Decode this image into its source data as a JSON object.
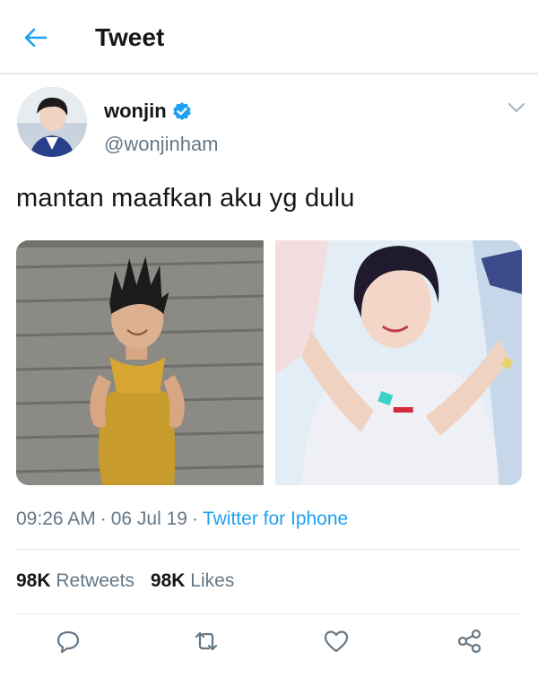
{
  "header": {
    "title": "Tweet",
    "back_icon": "arrow-left-icon"
  },
  "tweet": {
    "author": {
      "display_name": "wonjin",
      "handle": "@wonjinham",
      "verified": true
    },
    "text": "mantan maafkan aku yg dulu",
    "time": "09:26 AM",
    "date": "06 Jul 19",
    "separator": "·",
    "source": "Twitter for Iphone",
    "retweets_count": "98K",
    "retweets_label": "Retweets",
    "likes_count": "98K",
    "likes_label": "Likes"
  },
  "actions": [
    "reply-icon",
    "retweet-icon",
    "like-icon",
    "share-icon"
  ],
  "colors": {
    "accent": "#1da1f2",
    "text": "#14171a",
    "muted": "#657786",
    "divider": "#e1e8ed"
  }
}
